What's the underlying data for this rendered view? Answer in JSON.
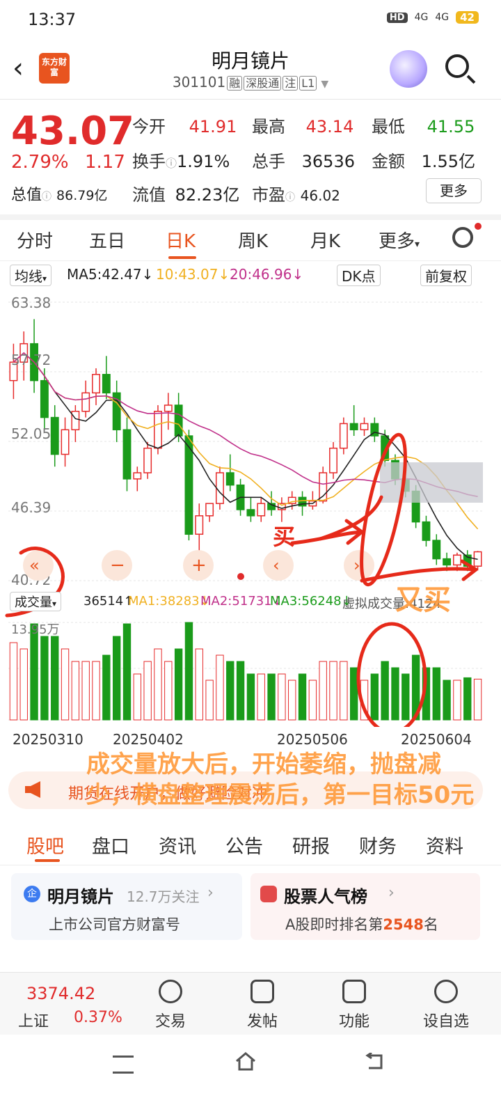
{
  "status_bar": {
    "time": "13:37",
    "hd": "HD",
    "net1": "4G",
    "net2": "4G",
    "battery": "42"
  },
  "header": {
    "logo_text": "东方财富",
    "stock_name": "明月镜片",
    "code": "301101",
    "tags": [
      "融",
      "深股通",
      "注",
      "L1"
    ]
  },
  "quote": {
    "price": "43.07",
    "change_pct": "2.79%",
    "change": "1.17",
    "open_label": "今开",
    "open": "41.91",
    "high_label": "最高",
    "high": "43.14",
    "low_label": "最低",
    "low": "41.55",
    "turnover_label": "换手",
    "turnover": "1.91%",
    "vol_label": "总手",
    "vol": "36536",
    "amount_label": "金额",
    "amount": "1.55亿",
    "mcap_label": "总值",
    "mcap": "86.79亿",
    "float_label": "流值",
    "float": "82.23亿",
    "pe_label": "市盈",
    "pe": "46.02",
    "more": "更多"
  },
  "tabs": [
    "分时",
    "五日",
    "日K",
    "周K",
    "月K",
    "更多"
  ],
  "ma_bar": {
    "type": "均线",
    "ma5": "MA5:42.47",
    "ma10": "10:43.07",
    "ma20": "20:46.96",
    "dk": "DK点",
    "fq": "前复权"
  },
  "y_labels": [
    "63.38",
    "57.72",
    "52.05",
    "46.39",
    "40.72"
  ],
  "vol_bar": {
    "type": "成交量",
    "v": "36514",
    "ma1": "MA1:38283",
    "ma2": "MA2:51731",
    "ma3": "MA3:56248",
    "virtual": "虚拟成交量:4124"
  },
  "vol_max": "13.95万",
  "dates": [
    "20250310",
    "20250402",
    "20250506",
    "20250604"
  ],
  "annotations": {
    "buy": "买",
    "buy_again": "又买",
    "note": "成交量放大后，开始萎缩，抛盘减少，横盘整理震荡后，第一目标50元"
  },
  "banner": "期货在线开户，做好避险对冲",
  "section_tabs": [
    "股吧",
    "盘口",
    "资讯",
    "公告",
    "研报",
    "财务",
    "资料"
  ],
  "card1": {
    "badge": "企",
    "title": "明月镜片",
    "follow": "12.7万关注",
    "sub": "上市公司官方财富号"
  },
  "card2": {
    "title": "股票人气榜",
    "sub_prefix": "A股即时排名第",
    "rank": "2548",
    "sub_suffix": "名"
  },
  "bottom_nav": {
    "index_value": "3374.42",
    "index_name": "上证",
    "index_pct": "0.37%",
    "trade": "交易",
    "post": "发帖",
    "func": "功能",
    "watch": "设自选"
  },
  "chart_data": {
    "type": "candlestick",
    "y_range": [
      40.72,
      63.38
    ],
    "candles": [
      [
        57,
        60,
        55.5,
        58.5
      ],
      [
        58.5,
        61,
        57,
        60
      ],
      [
        60,
        62,
        56,
        57
      ],
      [
        57,
        58,
        53,
        54
      ],
      [
        54,
        55,
        50,
        51
      ],
      [
        51,
        54,
        50,
        53
      ],
      [
        53,
        55,
        52,
        54.5
      ],
      [
        54.5,
        57,
        54,
        56
      ],
      [
        56,
        58,
        55,
        57.5
      ],
      [
        57.5,
        59,
        55.5,
        56
      ],
      [
        56,
        57,
        52,
        53
      ],
      [
        53,
        54,
        48,
        49
      ],
      [
        49,
        50,
        48,
        49.5
      ],
      [
        49.5,
        52,
        49,
        51.5
      ],
      [
        51.5,
        55,
        51,
        54.5
      ],
      [
        54.5,
        56,
        53,
        55
      ],
      [
        55,
        56,
        52,
        52.5
      ],
      [
        52.5,
        53,
        44,
        44.5
      ],
      [
        44.5,
        47,
        43,
        46
      ],
      [
        46,
        47,
        45.5,
        47
      ],
      [
        47,
        50,
        46.5,
        49.5
      ],
      [
        49.5,
        51,
        48,
        48.5
      ],
      [
        48.5,
        49,
        46,
        46.5
      ],
      [
        46.5,
        47.5,
        45.5,
        46
      ],
      [
        46,
        47.5,
        45.5,
        47
      ],
      [
        47,
        48,
        46,
        46.5
      ],
      [
        46.5,
        47.5,
        45.5,
        47
      ],
      [
        47,
        48,
        46.5,
        47.5
      ],
      [
        47.5,
        48,
        46,
        46.8
      ],
      [
        46.8,
        48,
        46.5,
        47.2
      ],
      [
        47.2,
        50,
        47,
        49.5
      ],
      [
        49.5,
        52,
        49,
        51.5
      ],
      [
        51.5,
        54,
        51,
        53.5
      ],
      [
        53.5,
        55,
        52.5,
        53
      ],
      [
        53,
        54,
        52.5,
        53.5
      ],
      [
        53.5,
        54,
        52,
        52.5
      ],
      [
        52.5,
        53,
        50,
        50.5
      ],
      [
        50.5,
        51,
        48.5,
        49
      ],
      [
        49,
        49.5,
        47.5,
        48
      ],
      [
        48,
        48.5,
        45,
        45.5
      ],
      [
        45.5,
        46,
        43.5,
        44
      ],
      [
        44,
        44.5,
        42,
        42.5
      ],
      [
        42.5,
        43,
        41.5,
        42
      ],
      [
        42,
        43,
        41.5,
        42.8
      ],
      [
        42.8,
        43.2,
        41.5,
        41.9
      ],
      [
        41.9,
        43.14,
        41.55,
        43.07
      ]
    ]
  }
}
